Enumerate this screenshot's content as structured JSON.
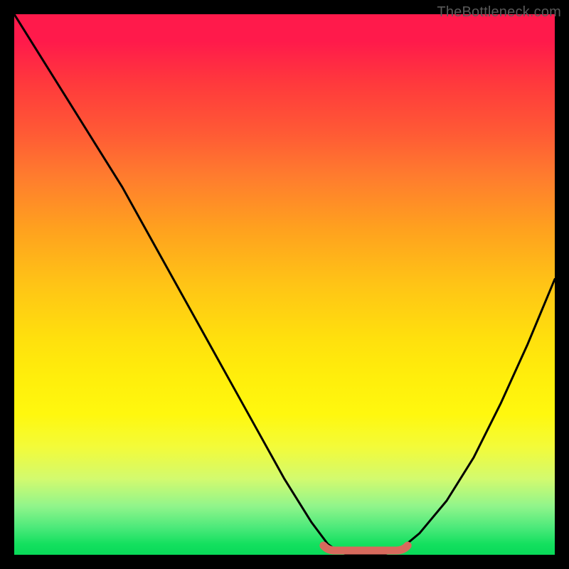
{
  "attribution": "TheBottleneck.com",
  "chart_data": {
    "type": "line",
    "title": "",
    "xlabel": "",
    "ylabel": "",
    "xlim": [
      0,
      100
    ],
    "ylim": [
      0,
      100
    ],
    "x": [
      0,
      5,
      10,
      15,
      20,
      25,
      30,
      35,
      40,
      45,
      50,
      55,
      58,
      60,
      62,
      65,
      68,
      70,
      72,
      75,
      80,
      85,
      90,
      95,
      100
    ],
    "values": [
      100,
      92,
      84,
      76,
      68,
      59,
      50,
      41,
      32,
      23,
      14,
      6,
      2,
      0.5,
      0,
      0,
      0,
      0.5,
      1.5,
      4,
      10,
      18,
      28,
      39,
      51
    ],
    "flat_segment": {
      "x0": 58,
      "x1": 72,
      "y": 0
    },
    "flat_segment_color": "#d86a5d",
    "gradient_stops": [
      {
        "pos": 0.0,
        "color": "#ff1a4b"
      },
      {
        "pos": 0.2,
        "color": "#ff5a35"
      },
      {
        "pos": 0.4,
        "color": "#ffa21e"
      },
      {
        "pos": 0.6,
        "color": "#ffe00d"
      },
      {
        "pos": 0.8,
        "color": "#d2fa6f"
      },
      {
        "pos": 1.0,
        "color": "#08d958"
      }
    ]
  }
}
